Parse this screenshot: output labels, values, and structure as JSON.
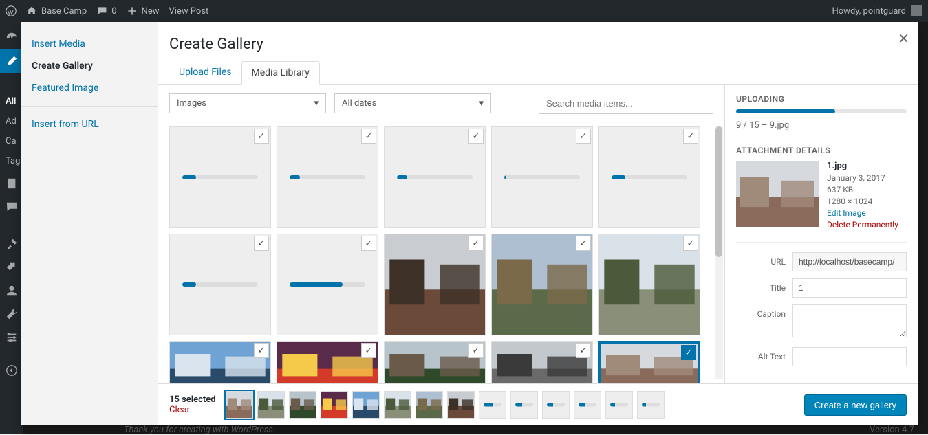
{
  "adminbar": {
    "site_name": "Base Camp",
    "comments": "0",
    "new": "New",
    "view_post": "View Post",
    "howdy": "Howdy, pointguard"
  },
  "pages_strip": [
    "All",
    "Ad",
    "Ca",
    "Tag"
  ],
  "sidebar": {
    "items": [
      {
        "label": "Insert Media"
      },
      {
        "label": "Create Gallery"
      },
      {
        "label": "Featured Image"
      },
      {
        "label": "Insert from URL"
      }
    ],
    "active_index": 1
  },
  "modal": {
    "title": "Create Gallery",
    "tabs": {
      "upload": "Upload Files",
      "library": "Media Library"
    },
    "filter_type": "Images",
    "filter_date": "All dates",
    "search_placeholder": "Search media items..."
  },
  "thumbs": {
    "row1": [
      {
        "kind": "upload",
        "progress": 18
      },
      {
        "kind": "upload",
        "progress": 14
      },
      {
        "kind": "upload",
        "progress": 14
      },
      {
        "kind": "upload",
        "progress": 2
      },
      {
        "kind": "upload",
        "progress": 18
      }
    ],
    "row2": [
      {
        "kind": "upload",
        "progress": 18
      },
      {
        "kind": "upload",
        "progress": 70
      },
      {
        "kind": "photo",
        "palette": "brick"
      },
      {
        "kind": "photo",
        "palette": "harbor"
      },
      {
        "kind": "photo",
        "palette": "pier"
      }
    ],
    "row3": [
      {
        "kind": "photo",
        "palette": "ferry"
      },
      {
        "kind": "photo",
        "palette": "neon"
      },
      {
        "kind": "photo",
        "palette": "trees"
      },
      {
        "kind": "photo",
        "palette": "canal"
      },
      {
        "kind": "photo",
        "palette": "street",
        "selected": true
      }
    ]
  },
  "uploading": {
    "heading": "UPLOADING",
    "progress_pct": 58,
    "done": 9,
    "total": 15,
    "current_file": "9.jpg",
    "status_text": "9 / 15  –  9.jpg"
  },
  "attachment": {
    "heading": "ATTACHMENT DETAILS",
    "filename": "1.jpg",
    "date": "January 3, 2017",
    "size": "637 KB",
    "dimensions": "1280 × 1024",
    "edit": "Edit Image",
    "delete": "Delete Permanently",
    "url_label": "URL",
    "url_value": "http://localhost/basecamp/",
    "title_label": "Title",
    "title_value": "1",
    "caption_label": "Caption",
    "caption_value": "",
    "alt_label": "Alt Text"
  },
  "footer": {
    "selected_count": "15 selected",
    "clear": "Clear",
    "button": "Create a new gallery",
    "mini_count": 15,
    "mini": [
      {
        "kind": "photo",
        "palette": "street",
        "sel": true
      },
      {
        "kind": "photo",
        "palette": "pier"
      },
      {
        "kind": "photo",
        "palette": "trees"
      },
      {
        "kind": "photo",
        "palette": "neon"
      },
      {
        "kind": "photo",
        "palette": "ferry"
      },
      {
        "kind": "photo",
        "palette": "pier"
      },
      {
        "kind": "photo",
        "palette": "harbor"
      },
      {
        "kind": "photo",
        "palette": "brick"
      },
      {
        "kind": "upload",
        "p": 55
      },
      {
        "kind": "upload",
        "p": 40
      },
      {
        "kind": "upload",
        "p": 35
      },
      {
        "kind": "upload",
        "p": 35
      },
      {
        "kind": "upload",
        "p": 30
      },
      {
        "kind": "upload",
        "p": 25
      }
    ]
  },
  "page": {
    "thank_you": "Thank you for creating with WordPress.",
    "version": "Version 4.7"
  }
}
